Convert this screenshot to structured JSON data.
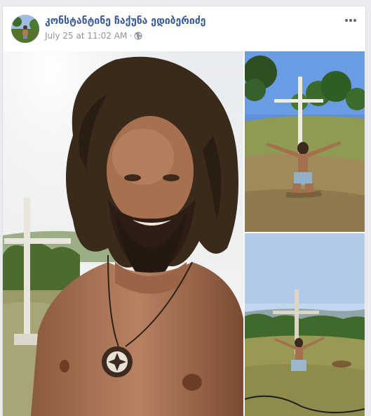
{
  "post": {
    "author_name": "კონსტანტინე ჩაქუნა ედიბერიძე",
    "date": "July 25 at 11:02 AM",
    "separator": "·",
    "privacy_icon": "globe-icon",
    "more_icon": "more-options-icon"
  },
  "photos": [
    {
      "name": "selfie-photo",
      "description_icon": "photo"
    },
    {
      "name": "cross-kneeling-photo-1",
      "description_icon": "photo"
    },
    {
      "name": "cross-kneeling-photo-2",
      "description_icon": "photo"
    }
  ],
  "colors": {
    "author_link": "#385898",
    "meta_text": "#90949c",
    "page_bg": "#e9ebee",
    "card_bg": "#ffffff"
  }
}
